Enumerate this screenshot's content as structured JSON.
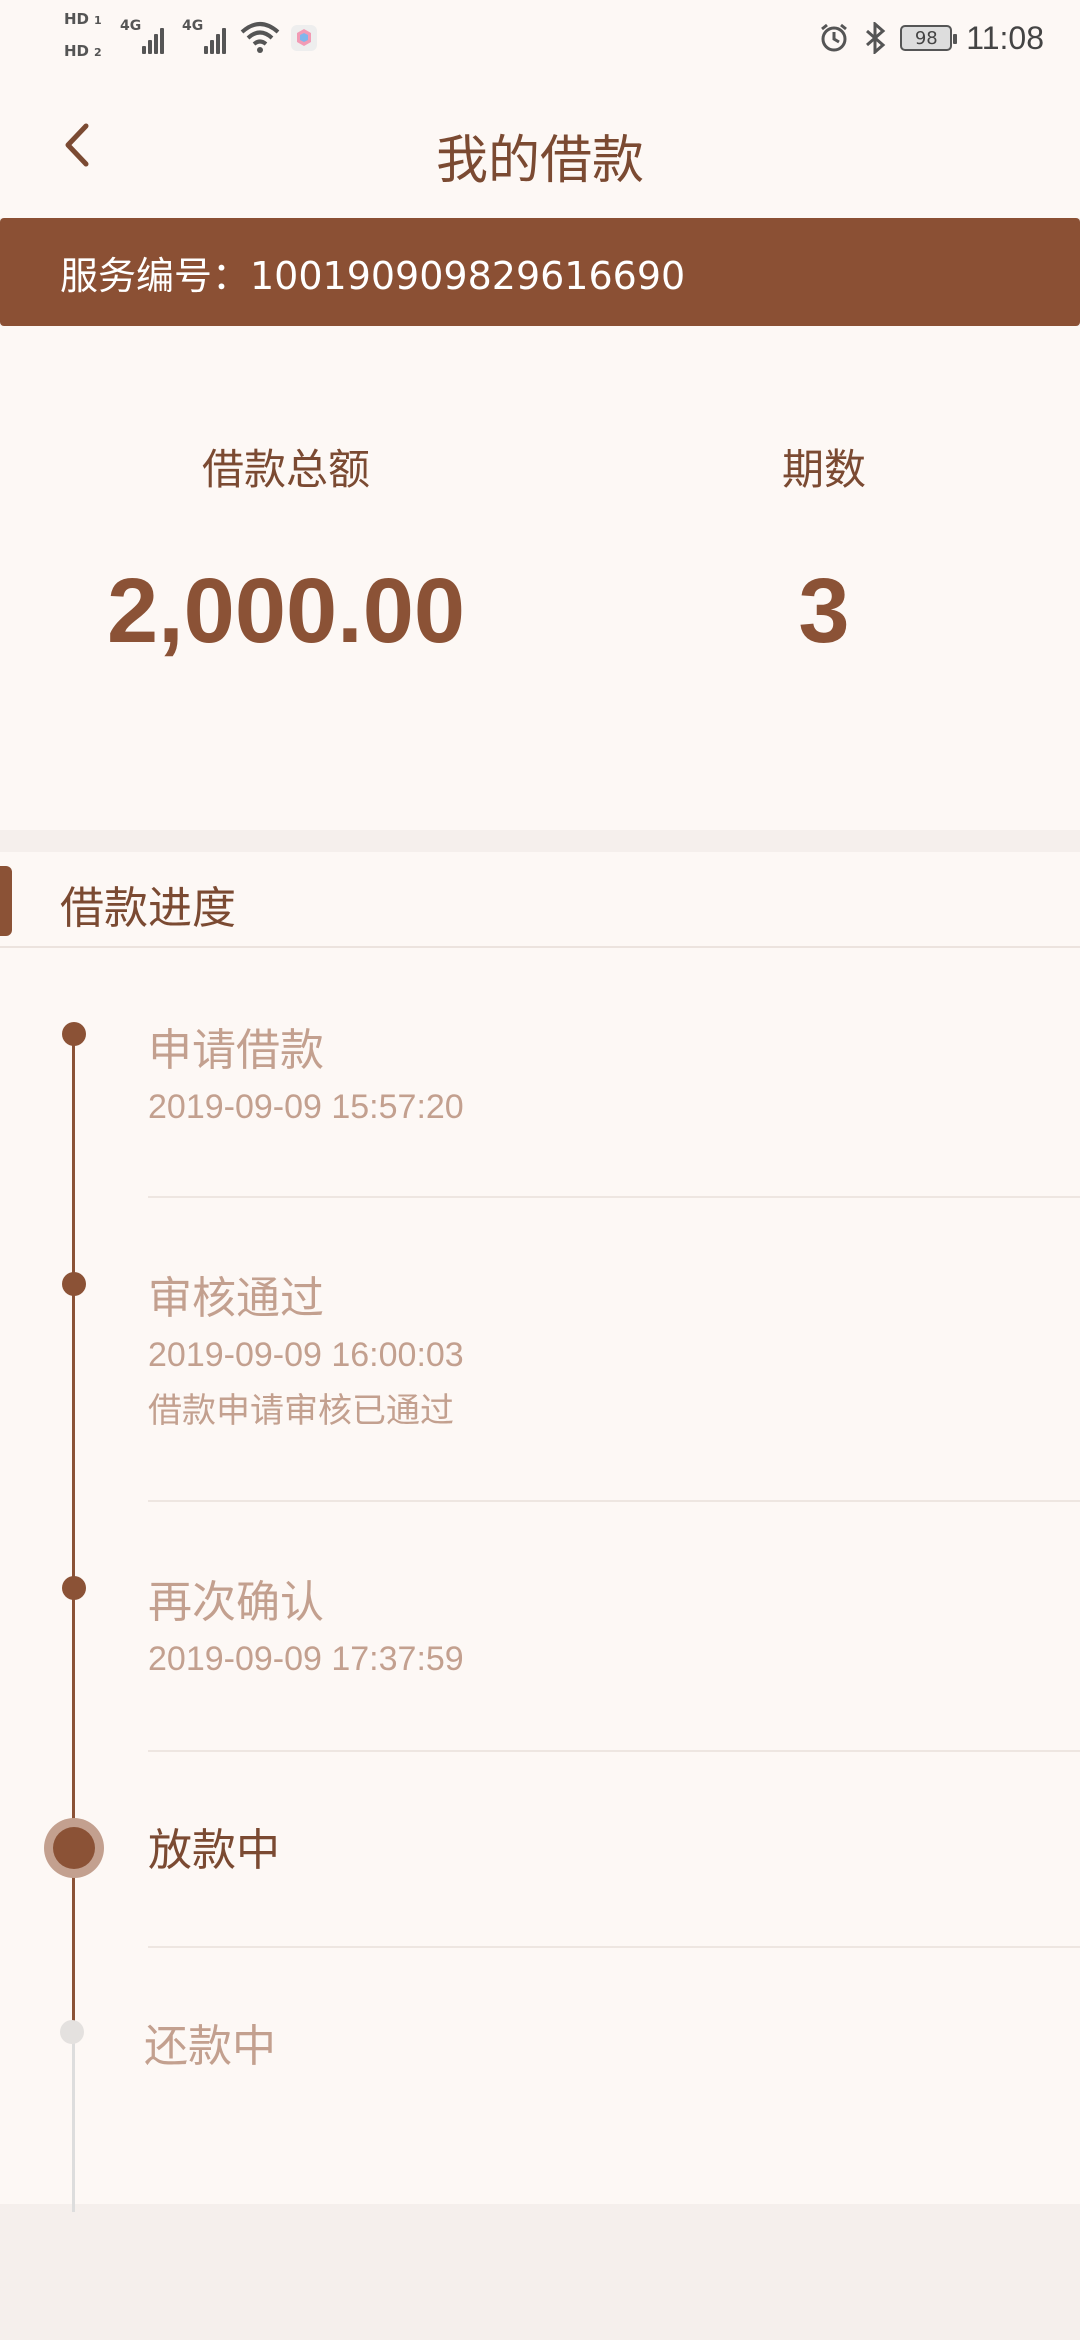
{
  "status_bar": {
    "hd1": "HD",
    "hd1_sub": "1",
    "hd2": "HD",
    "hd2_sub": "2",
    "sig1": "4G",
    "sig2": "4G",
    "battery": "98",
    "time": "11:08"
  },
  "header": {
    "title": "我的借款"
  },
  "service": {
    "text": "服务编号：100190909829616690"
  },
  "summary": {
    "amount_label": "借款总额",
    "amount_value": "2,000.00",
    "periods_label": "期数",
    "periods_value": "3"
  },
  "progress": {
    "title": "借款进度",
    "steps": [
      {
        "title": "申请借款",
        "time": "2019-09-09 15:57:20",
        "note": ""
      },
      {
        "title": "审核通过",
        "time": "2019-09-09 16:00:03",
        "note": "借款申请审核已通过"
      },
      {
        "title": "再次确认",
        "time": "2019-09-09 17:37:59",
        "note": ""
      },
      {
        "title": "放款中",
        "time": "",
        "note": ""
      },
      {
        "title": "还款中",
        "time": "",
        "note": ""
      }
    ]
  },
  "colors": {
    "brand": "#8b5034",
    "text_dark": "#7b4a32",
    "text_muted": "#c3a08f",
    "page_bg": "#fdf8f5",
    "outer_bg": "#f5efec"
  }
}
